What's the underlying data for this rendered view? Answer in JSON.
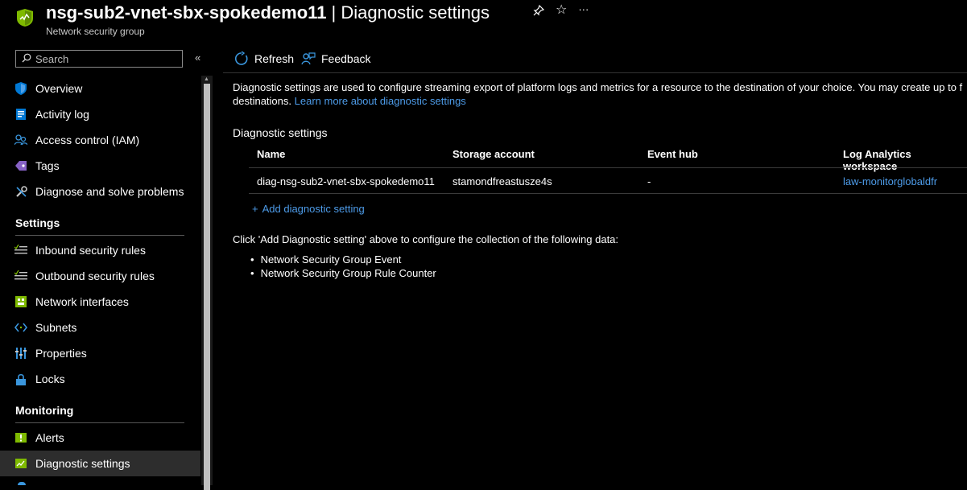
{
  "header": {
    "resource_name": "nsg-sub2-vnet-sbx-spokedemo11",
    "separator": " | ",
    "page_name": "Diagnostic settings",
    "subtitle": "Network security group",
    "pin_icon": "pin-icon",
    "star_icon": "star-icon",
    "more_icon": "more-icon"
  },
  "sidebar": {
    "search_placeholder": "Search",
    "collapse_label": "«",
    "items": [
      {
        "label": "Overview",
        "icon": "shield-icon"
      },
      {
        "label": "Activity log",
        "icon": "activity-log-icon"
      },
      {
        "label": "Access control (IAM)",
        "icon": "people-icon"
      },
      {
        "label": "Tags",
        "icon": "tag-icon"
      },
      {
        "label": "Diagnose and solve problems",
        "icon": "wrench-icon"
      }
    ],
    "settings_header": "Settings",
    "settings_items": [
      {
        "label": "Inbound security rules",
        "icon": "inbound-rules-icon"
      },
      {
        "label": "Outbound security rules",
        "icon": "outbound-rules-icon"
      },
      {
        "label": "Network interfaces",
        "icon": "nic-icon"
      },
      {
        "label": "Subnets",
        "icon": "subnet-icon"
      },
      {
        "label": "Properties",
        "icon": "properties-icon"
      },
      {
        "label": "Locks",
        "icon": "lock-icon"
      }
    ],
    "monitoring_header": "Monitoring",
    "monitoring_items": [
      {
        "label": "Alerts",
        "icon": "alert-icon"
      },
      {
        "label": "Diagnostic settings",
        "icon": "diagnostic-settings-icon",
        "active": true
      }
    ]
  },
  "toolbar": {
    "refresh_label": "Refresh",
    "feedback_label": "Feedback"
  },
  "main": {
    "description_line1": "Diagnostic settings are used to configure streaming export of platform logs and metrics for a resource to the destination of your choice. You may create up to f",
    "description_line2": "destinations.",
    "learn_more": "Learn more about diagnostic settings",
    "section_label": "Diagnostic settings",
    "table": {
      "columns": [
        "Name",
        "Storage account",
        "Event hub",
        "Log Analytics workspace"
      ],
      "rows": [
        [
          "diag-nsg-sub2-vnet-sbx-spokedemo11",
          "stamondfreastusze4s",
          "-",
          "law-monitorglobaldfr"
        ]
      ]
    },
    "add_setting": "Add diagnostic setting",
    "info_text": "Click 'Add Diagnostic setting' above to configure the collection of the following data:",
    "data_items": [
      "Network Security Group Event",
      "Network Security Group Rule Counter"
    ]
  },
  "colors": {
    "background": "#000000",
    "link": "#4d9be8",
    "accent_green": "#7fba00",
    "active_item": "#2d2d2d"
  }
}
